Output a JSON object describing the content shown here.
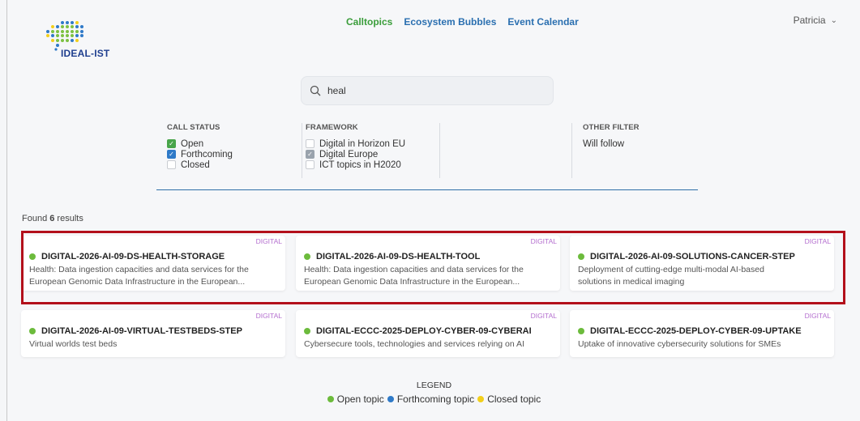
{
  "brand": {
    "logo_text": "IDEAL-IST"
  },
  "nav": {
    "items": [
      {
        "label": "Calltopics",
        "active": true
      },
      {
        "label": "Ecosystem Bubbles",
        "active": false
      },
      {
        "label": "Event Calendar",
        "active": false
      }
    ]
  },
  "user": {
    "name": "Patricia"
  },
  "search": {
    "value": "heal"
  },
  "filters": {
    "call_status": {
      "title": "CALL STATUS",
      "options": [
        {
          "label": "Open",
          "state": "checked-green"
        },
        {
          "label": "Forthcoming",
          "state": "checked-blue"
        },
        {
          "label": "Closed",
          "state": "unchecked"
        }
      ]
    },
    "framework": {
      "title": "FRAMEWORK",
      "options": [
        {
          "label": "Digital in Horizon EU",
          "state": "unchecked"
        },
        {
          "label": "Digital Europe",
          "state": "checked-grey"
        },
        {
          "label": "ICT topics in H2020",
          "state": "unchecked"
        }
      ]
    },
    "other": {
      "title": "OTHER FILTER",
      "text": "Will follow"
    }
  },
  "results": {
    "prefix": "Found ",
    "count": "6",
    "suffix": " results"
  },
  "cards": [
    {
      "tag": "DIGITAL",
      "title": "DIGITAL-2026-AI-09-DS-HEALTH-STORAGE",
      "desc1": "Health: Data ingestion capacities and data services for the",
      "desc2": "European Genomic Data Infrastructure in the European..."
    },
    {
      "tag": "DIGITAL",
      "title": "DIGITAL-2026-AI-09-DS-HEALTH-TOOL",
      "desc1": "Health: Data ingestion capacities and data services for the",
      "desc2": "European Genomic Data Infrastructure in the European..."
    },
    {
      "tag": "DIGITAL",
      "title": "DIGITAL-2026-AI-09-SOLUTIONS-CANCER-STEP",
      "desc1": "Deployment of cutting-edge multi-modal AI-based",
      "desc2": "solutions in medical imaging"
    },
    {
      "tag": "DIGITAL",
      "title": "DIGITAL-2026-AI-09-VIRTUAL-TESTBEDS-STEP",
      "desc1": "Virtual worlds test beds",
      "desc2": ""
    },
    {
      "tag": "DIGITAL",
      "title": "DIGITAL-ECCC-2025-DEPLOY-CYBER-09-CYBERAI",
      "desc1": "Cybersecure tools, technologies and services relying on AI",
      "desc2": ""
    },
    {
      "tag": "DIGITAL",
      "title": "DIGITAL-ECCC-2025-DEPLOY-CYBER-09-UPTAKE",
      "desc1": "Uptake of innovative cybersecurity solutions for SMEs",
      "desc2": ""
    }
  ],
  "legend": {
    "title": "LEGEND",
    "items": [
      {
        "label": "Open topic",
        "color": "#6cbb3c"
      },
      {
        "label": "Forthcoming topic",
        "color": "#2f7ac8"
      },
      {
        "label": "Closed topic",
        "color": "#f2cf1b"
      }
    ]
  },
  "colors": {
    "accent_green": "#3a9d3a",
    "link_blue": "#2a6fb0",
    "highlight_red": "#b3101b",
    "tag_purple": "#b46fcf"
  }
}
